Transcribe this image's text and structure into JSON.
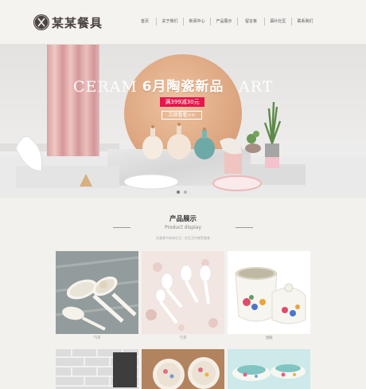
{
  "brand": {
    "name": "某某餐具"
  },
  "nav": [
    {
      "label": "首页"
    },
    {
      "label": "关于我们"
    },
    {
      "label": "新闻中心"
    },
    {
      "label": "产品展示"
    },
    {
      "label": "留言板"
    },
    {
      "label": "図片社区"
    },
    {
      "label": "联系我们"
    }
  ],
  "banner": {
    "bg_left": "CERAM",
    "bg_right": "ART",
    "title": "6月陶瓷新品",
    "promo": "满399减30元",
    "button": "立即看看>>",
    "slides": 2,
    "active_slide": 1
  },
  "products": {
    "title": "产品展示",
    "subtitle": "Product display",
    "description": "在美食中体味生活，在生活中感受美食",
    "items": [
      {
        "caption": "勺子",
        "icon": "ceramic-spoons"
      },
      {
        "caption": "勺子",
        "icon": "white-spoons"
      },
      {
        "caption": "汤碗",
        "icon": "soup-tureen"
      },
      {
        "caption": "",
        "icon": "brick-wall-dishes"
      },
      {
        "caption": "",
        "icon": "floral-bowls"
      },
      {
        "caption": "",
        "icon": "teacups"
      }
    ]
  },
  "colors": {
    "accent": "#e8164d",
    "brand": "#4a4340",
    "background": "#f3f1ee"
  }
}
